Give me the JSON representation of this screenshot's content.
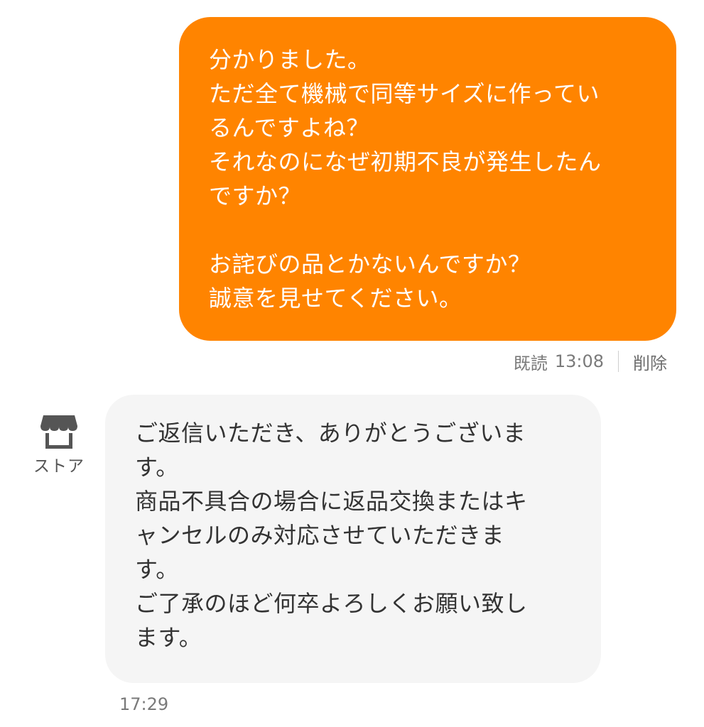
{
  "outgoing_message": {
    "lines": [
      "分かりました。",
      "ただ全て機械で同等サイズに作ってい",
      "るんですよね？",
      "それなのになぜ初期不良が発生したん",
      "ですか？",
      "",
      "お詫びの品とかないんですか？",
      "誠意を見せてください。"
    ],
    "read_status": "既読",
    "time": "13:08",
    "delete_label": "削除",
    "bubble_color": "#ff8400"
  },
  "incoming_message": {
    "sender_label": "ストア",
    "sender_icon": "store-icon",
    "lines": [
      "ご返信いただき、ありがとうございま",
      "す。",
      "商品不具合の場合に返品交換またはキ",
      "ャンセルのみ対応させていただきま",
      "す。",
      "ご了承のほど何卒よろしくお願い致し",
      "ます。"
    ],
    "time": "17:29",
    "bubble_color": "#f5f5f5"
  }
}
